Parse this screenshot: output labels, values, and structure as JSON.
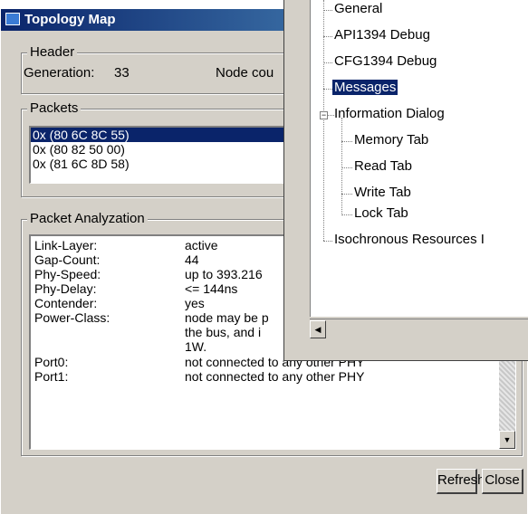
{
  "window": {
    "title": "Topology Map"
  },
  "header": {
    "legend": "Header",
    "generation_label": "Generation:",
    "generation_value": "33",
    "node_count_label": "Node cou"
  },
  "packets": {
    "legend": "Packets",
    "items": [
      "0x (80 6C 8C 55)",
      "0x (80 82 50 00)",
      "0x (81 6C 8D 58)"
    ]
  },
  "analysis": {
    "legend": "Packet Analyzation",
    "rows": [
      {
        "label": "Link-Layer:",
        "value": "active"
      },
      {
        "label": "Gap-Count:",
        "value": "44"
      },
      {
        "label": "Phy-Speed:",
        "value": "up to 393.216"
      },
      {
        "label": "Phy-Delay:",
        "value": "<= 144ns"
      },
      {
        "label": "Contender:",
        "value": "yes"
      },
      {
        "label": "Power-Class:",
        "value": "node may be p"
      },
      {
        "label": "",
        "value": "the bus, and i"
      },
      {
        "label": "",
        "value": "1W."
      },
      {
        "label": "Port0:",
        "value": "not connected to any other PHY"
      },
      {
        "label": "Port1:",
        "value": "not connected to any other PHY"
      }
    ]
  },
  "buttons": {
    "refresh": "Refresh",
    "close": "Close"
  },
  "tree": {
    "items": [
      "General",
      "API1394 Debug",
      "CFG1394 Debug",
      "Messages",
      "Information Dialog",
      "Memory Tab",
      "Read Tab",
      "Write Tab",
      "Lock Tab",
      "Isochronous Resources I"
    ],
    "selected": "Messages"
  }
}
